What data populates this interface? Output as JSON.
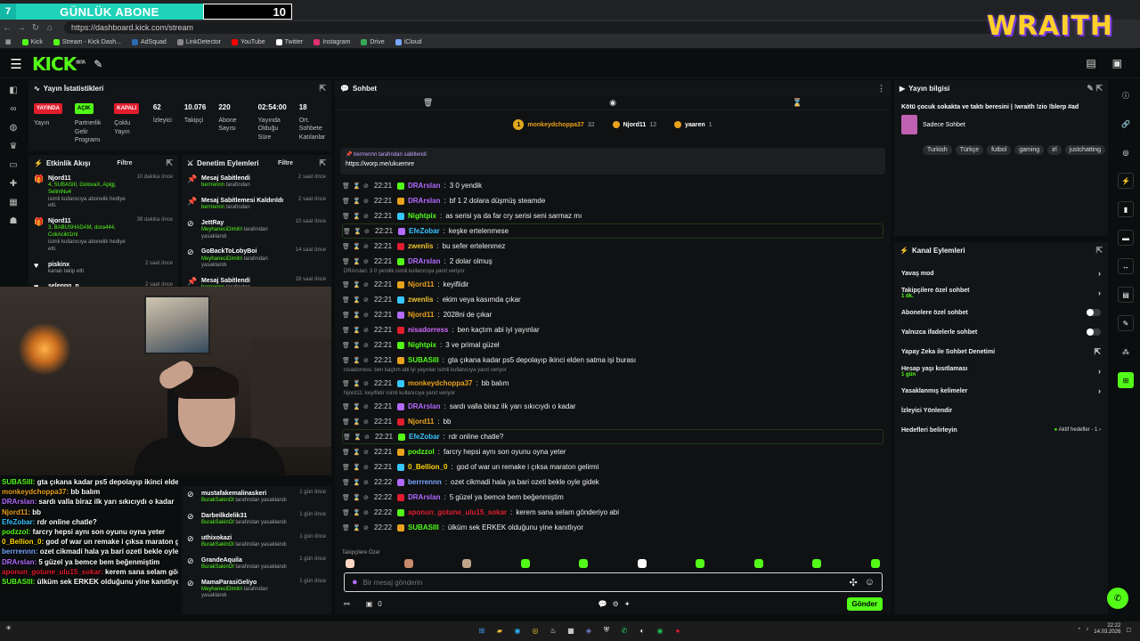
{
  "overlay": {
    "left_num": "7",
    "label": "GÜNLÜK ABONE",
    "count": "10"
  },
  "browser": {
    "url": "https://dashboard.kick.com/stream",
    "bookmarks": [
      {
        "label": "Kick",
        "color": "#53fc18"
      },
      {
        "label": "Stream - Kick Dash...",
        "color": "#53fc18"
      },
      {
        "label": "AdSquad",
        "color": "#2b6cb0"
      },
      {
        "label": "LinkDetector",
        "color": "#888888"
      },
      {
        "label": "YouTube",
        "color": "#ff0000"
      },
      {
        "label": "Twitter",
        "color": "#ffffff"
      },
      {
        "label": "Instagram",
        "color": "#e1306c"
      },
      {
        "label": "Drive",
        "color": "#34a853"
      },
      {
        "label": "iCloud",
        "color": "#7aa7ff"
      }
    ]
  },
  "brand": {
    "logo": "KICK",
    "beta": "BETA",
    "wraith": "WRAITH"
  },
  "stats": {
    "title": "Yayın İstatistikleri",
    "items": [
      {
        "badge": "YAYINDA",
        "badge_type": "red",
        "label": "Yayın"
      },
      {
        "badge": "AÇIK",
        "badge_type": "green",
        "label": "Partnerlik Gelir Programı"
      },
      {
        "badge": "KAPALI",
        "badge_type": "red",
        "label": "Çoklu Yayın"
      },
      {
        "value": "62",
        "label": "İzleyici"
      },
      {
        "value": "10.076",
        "label": "Takipçi"
      },
      {
        "value": "220",
        "label": "Abone Sayısı"
      },
      {
        "value": "02:54:00",
        "label": "Yayında Olduğu Süre"
      },
      {
        "value": "18",
        "label": "Ort. Sohbete Katılanlar"
      }
    ]
  },
  "activity": {
    "title": "Etkinlik Akışı",
    "filter": "Filtre",
    "items": [
      {
        "name": "Njord11",
        "gifts": "4, SUBASIII, GolovaX, Apigj, SelimNu4",
        "sub": "isimli kullanıcıya abonelik hediye etti.",
        "time": "10 dakika önce",
        "icon": "🎁"
      },
      {
        "name": "Njord11",
        "gifts": "3, BABUSHADAM, dora444, CokAcikt1ml",
        "sub": "isimli kullanıcıya abonelik hediye etti.",
        "time": "38 dakika önce",
        "icon": "🎁"
      },
      {
        "name": "piskinx",
        "gifts": "",
        "sub": "kanalı takip etti",
        "time": "2 saat önce",
        "icon": "♥"
      },
      {
        "name": "selennn_n",
        "gifts": "",
        "sub": "kanalı takip etti",
        "time": "2 saat önce",
        "icon": "♥"
      }
    ]
  },
  "modactions": {
    "title": "Denetim Eylemleri",
    "filter": "Filtre",
    "items": [
      {
        "action": "Mesaj Sabitlendi",
        "by": "berrrennn",
        "suffix": "tarafından",
        "time": "2 saat önce"
      },
      {
        "action": "Mesaj Sabitlemesi Kaldırıldı",
        "by": "berrrennn",
        "suffix": "tarafından",
        "time": "2 saat önce"
      },
      {
        "action": "JettRay",
        "by": "MeyhaneciDimitri",
        "suffix": "tarafından yasaklandı",
        "time": "10 saat önce"
      },
      {
        "action": "GoBackToLobyBoi",
        "by": "MeyhaneciDimitri",
        "suffix": "tarafından yasaklandı",
        "time": "14 saat önce"
      },
      {
        "action": "Mesaj Sabitlendi",
        "by": "berrrennn",
        "suffix": "tarafından",
        "time": "18 saat önce"
      }
    ],
    "lower": [
      {
        "action": "mustafakemalinaskeri",
        "by": "BurakSakinOl",
        "suffix": "tarafından yasaklandı",
        "time": "1 gün önce"
      },
      {
        "action": "Darbeilkdelik31",
        "by": "BurakSakinOl",
        "suffix": "tarafından yasaklandı",
        "time": "1 gün önce"
      },
      {
        "action": "uthixokazi",
        "by": "BurakSakinOl",
        "suffix": "tarafından yasaklandı",
        "time": "1 gün önce"
      },
      {
        "action": "GrandeAquila",
        "by": "BurakSakinOl",
        "suffix": "tarafından yasaklandı",
        "time": "1 gün önce"
      },
      {
        "action": "MamaParasiGeliyo",
        "by": "MeyhaneciDimitri",
        "suffix": "tarafından yasaklandı",
        "time": "1 gün önce"
      }
    ]
  },
  "overlay_chat": [
    {
      "user": "SUBASIII:",
      "text": "gta çıkana kadar ps5 depolayıp ikinci elden satma işi burası",
      "color": "#53fc18"
    },
    {
      "user": "monkeydchoppa37:",
      "text": "bb balım",
      "color": "#e9a21b"
    },
    {
      "user": "DRArslan:",
      "text": "sardı valla biraz ilk yarı sıkıcıydı o kadar",
      "color": "#b36bff"
    },
    {
      "user": "Njord11:",
      "text": "bb",
      "color": "#e9a21b"
    },
    {
      "user": "EfeZobar:",
      "text": "rdr online chatle?",
      "color": "#37c7ff"
    },
    {
      "user": "podzzol:",
      "text": "farcry hepsi aynı son oyunu oyna yeter",
      "color": "#53fc18"
    },
    {
      "user": "0_Bellion_0:",
      "text": "god of war un remake i çıksa maraton gelirmi",
      "color": "#ffd700"
    },
    {
      "user": "berrrennn:",
      "text": "ozet cikmadi hala ya bari ozeti bekle oyle gidek",
      "color": "#7aa7ff"
    },
    {
      "user": "DRArslan:",
      "text": "5 güzel ya bemce bem beğenmiştim",
      "color": "#b36bff"
    },
    {
      "user": "aponun_gotune_ulu15_sokar:",
      "text": "kerem sana selam gönderiyo abi",
      "color": "#e11d2e"
    },
    {
      "user": "SUBASIII:",
      "text": "ülküm sek ERKEK olduğunu yine kanıtlıyor",
      "color": "#53fc18"
    }
  ],
  "chat": {
    "title": "Sohbet",
    "top_gifters": [
      {
        "rank": "1",
        "name": "monkeydchoppa37",
        "count": "32"
      },
      {
        "rank": "",
        "name": "Njord11",
        "count": "12"
      },
      {
        "rank": "",
        "name": "yaaren",
        "count": "1"
      }
    ],
    "pinned_by": "berrrennn tarafından sabitlendi",
    "pinned_link": "https://worp.me/ukuemre",
    "messages": [
      {
        "time": "22:21",
        "user": "DRArslan",
        "color": "#b36bff",
        "text": "3 0 yendik",
        "reply": ""
      },
      {
        "time": "22:21",
        "user": "DRArslan",
        "color": "#b36bff",
        "text": "bf 1 2 dolara düşmüş steamde",
        "reply": ""
      },
      {
        "time": "22:21",
        "user": "Nightpix",
        "color": "#53fc18",
        "text": "as serisi ya da far cry serisi seni sarmaz mı",
        "reply": ""
      },
      {
        "time": "22:21",
        "user": "EfeZobar",
        "color": "#37c7ff",
        "text": "keşke ertelenmese",
        "reply": "",
        "hl": true
      },
      {
        "time": "22:21",
        "user": "zwenlis",
        "color": "#f0c330",
        "text": "bu sefer ertelenmez",
        "reply": ""
      },
      {
        "time": "22:21",
        "user": "DRArslan",
        "color": "#b36bff",
        "text": "2 dolar olmuş",
        "reply": ""
      },
      {
        "time": "22:21",
        "user": "Njord11",
        "color": "#e9a21b",
        "text": "keyiflidir",
        "reply": "DRArslan: 3 0 yendik isimli kullanıcıya yanıt veriyor"
      },
      {
        "time": "22:21",
        "user": "zwenlis",
        "color": "#f0c330",
        "text": "ekim veya kasımda çıkar",
        "reply": ""
      },
      {
        "time": "22:21",
        "user": "Njord11",
        "color": "#e9a21b",
        "text": "2028ni de çıkar",
        "reply": ""
      },
      {
        "time": "22:21",
        "user": "nisadorress",
        "color": "#d16bff",
        "text": "ben kaçtım abi iyi yayınlar",
        "reply": ""
      },
      {
        "time": "22:21",
        "user": "Nightpix",
        "color": "#53fc18",
        "text": "3 ve primal güzel",
        "reply": ""
      },
      {
        "time": "22:21",
        "user": "SUBASIII",
        "color": "#53fc18",
        "text": "gta çıkana kadar ps5 depolayıp ikinci elden satma işi burası",
        "reply": ""
      },
      {
        "time": "22:21",
        "user": "monkeydchoppa37",
        "color": "#e9a21b",
        "text": "bb balım",
        "reply": "nisadorress: ben kaçtım abi iyi yayınlar isimli kullanıcıya yanıt veriyor"
      },
      {
        "time": "22:21",
        "user": "DRArslan",
        "color": "#b36bff",
        "text": "sardı valla biraz ilk yarı sıkıcıydı o kadar",
        "reply": "Njord11: keyiflidir isimli kullanıcıya yanıt veriyor"
      },
      {
        "time": "22:21",
        "user": "Njord11",
        "color": "#e9a21b",
        "text": "bb",
        "reply": ""
      },
      {
        "time": "22:21",
        "user": "EfeZobar",
        "color": "#37c7ff",
        "text": "rdr online chatle?",
        "reply": "",
        "hl": true
      },
      {
        "time": "22:21",
        "user": "podzzol",
        "color": "#53fc18",
        "text": "farcry hepsi aynı son oyunu oyna yeter",
        "reply": ""
      },
      {
        "time": "22:21",
        "user": "0_Bellion_0",
        "color": "#ffd700",
        "text": "god of war un remake i çıksa maraton gelirmi",
        "reply": ""
      },
      {
        "time": "22:22",
        "user": "berrrennn",
        "color": "#7aa7ff",
        "text": "ozet cikmadi hala ya bari ozeti bekle oyle gidek",
        "reply": ""
      },
      {
        "time": "22:22",
        "user": "DRArslan",
        "color": "#b36bff",
        "text": "5 güzel ya bemce bem beğenmiştim",
        "reply": ""
      },
      {
        "time": "22:22",
        "user": "aponun_gotune_ulu15_sokar",
        "color": "#e11d2e",
        "text": "kerem sana selam gönderiyo abi",
        "reply": ""
      },
      {
        "time": "22:22",
        "user": "SUBASIII",
        "color": "#53fc18",
        "text": "ülküm sek ERKEK olduğunu yine kanıtlıyor",
        "reply": ""
      }
    ],
    "followers_label": "Takipçilere Özel",
    "placeholder": "Bir mesaj gönderin",
    "viewer_count": "0",
    "send_label": "Gönder"
  },
  "info": {
    "title": "Yayın bilgisi",
    "stream_title": "Kötü çocuk sokakta ve taktı beresini | !wraith !zio !blerp #ad",
    "mode": "Sadece Sohbet",
    "tags": [
      "Turkish",
      "Türkçe",
      "futbol",
      "gaming",
      "irl",
      "justchatting"
    ]
  },
  "channel": {
    "title": "Kanal Eylemleri",
    "rows": [
      {
        "label": "Yavaş mod",
        "sub": "",
        "control": "arrow"
      },
      {
        "label": "Takipçilere özel sohbet",
        "sub": "1 dk.",
        "control": "arrow"
      },
      {
        "label": "Abonelere özel sohbet",
        "sub": "",
        "control": "toggle"
      },
      {
        "label": "Yalnızca ifadelerle sohbet",
        "sub": "",
        "control": "toggle"
      },
      {
        "label": "Yapay Zeka ile Sohbet Denetimi",
        "sub": "",
        "control": "ext"
      },
      {
        "label": "Hesap yaşı kısıtlaması",
        "sub": "1 gün",
        "control": "arrow"
      },
      {
        "label": "Yasaklanmış kelimeler",
        "sub": "",
        "control": "arrow"
      },
      {
        "label": "İzleyici Yönlendir",
        "sub": "",
        "control": ""
      },
      {
        "label": "Hedefleri belirleyin",
        "sub": "",
        "control": "goal",
        "note": "Aktif hedefler - 1"
      }
    ]
  },
  "taskbar": {
    "time": "22:22",
    "date": "14.03.2026"
  }
}
